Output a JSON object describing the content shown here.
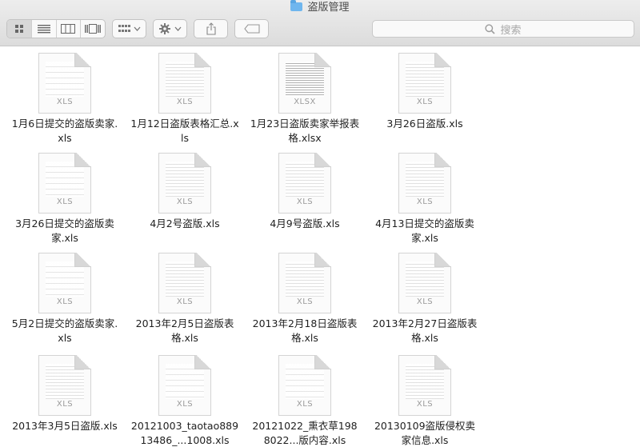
{
  "window": {
    "title": "盗版管理"
  },
  "toolbar": {
    "view_buttons": [
      "icon-view-icon",
      "list-view-icon",
      "column-view-icon",
      "gallery-view-icon"
    ],
    "arrange_icon": "grid-arrange-icon",
    "action_icon": "gear-icon",
    "share_icon": "share-icon",
    "tag_icon": "tag-icon"
  },
  "search": {
    "placeholder": "搜索",
    "icon": "search-icon"
  },
  "files": [
    {
      "name": "1月6日提交的盗版卖家.xls",
      "ext": "XLS",
      "thumb": "sparse"
    },
    {
      "name": "1月12日盗版表格汇总.xls",
      "ext": "XLS",
      "thumb": "normal"
    },
    {
      "name": "1月23日盗版卖家举报表格.xlsx",
      "ext": "XLSX",
      "thumb": "dense"
    },
    {
      "name": "3月26日盗版.xls",
      "ext": "XLS",
      "thumb": "normal"
    },
    {
      "name": "3月26日提交的盗版卖家.xls",
      "ext": "XLS",
      "thumb": "sparse"
    },
    {
      "name": "4月2号盗版.xls",
      "ext": "XLS",
      "thumb": "normal"
    },
    {
      "name": "4月9号盗版.xls",
      "ext": "XLS",
      "thumb": "normal"
    },
    {
      "name": "4月13日提交的盗版卖家.xls",
      "ext": "XLS",
      "thumb": "normal"
    },
    {
      "name": "5月2日提交的盗版卖家.xls",
      "ext": "XLS",
      "thumb": "sparse"
    },
    {
      "name": "2013年2月5日盗版表格.xls",
      "ext": "XLS",
      "thumb": "normal"
    },
    {
      "name": "2013年2月18日盗版表格.xls",
      "ext": "XLS",
      "thumb": "normal"
    },
    {
      "name": "2013年2月27日盗版表格.xls",
      "ext": "XLS",
      "thumb": "normal"
    },
    {
      "name": "2013年3月5日盗版.xls",
      "ext": "XLS",
      "thumb": "normal"
    },
    {
      "name": "20121003_taotao88913486_...1008.xls",
      "ext": "XLS",
      "thumb": "sparse"
    },
    {
      "name": "20121022_熏衣草1988022...版内容.xls",
      "ext": "XLS",
      "thumb": "sparse"
    },
    {
      "name": "20130109盗版侵权卖家信息.xls",
      "ext": "XLS",
      "thumb": "normal"
    }
  ]
}
